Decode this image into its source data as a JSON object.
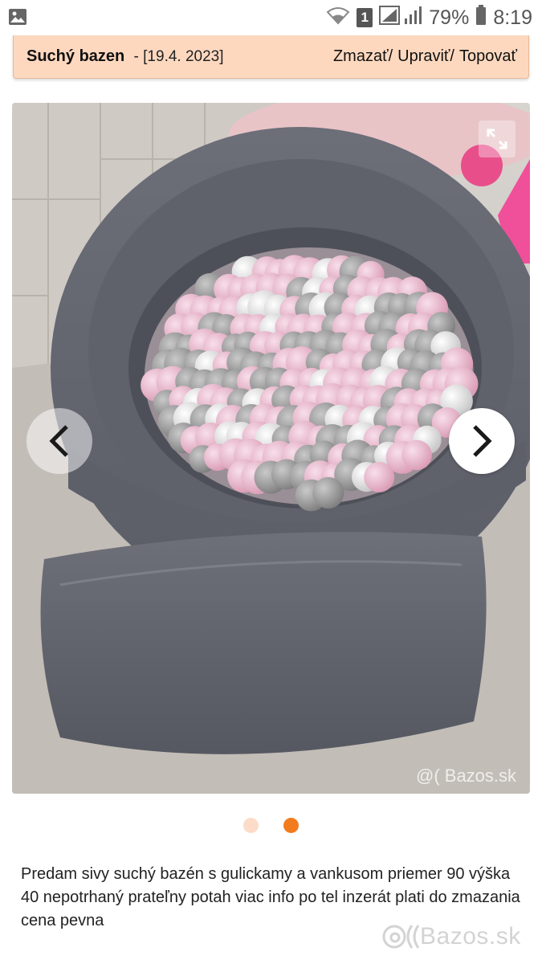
{
  "status_bar": {
    "sim_badge": "1",
    "battery": "79%",
    "time": "8:19",
    "icons": [
      "gallery-icon",
      "wifi-icon",
      "signal-icon",
      "battery-icon"
    ]
  },
  "ad": {
    "title": "Suchý bazen",
    "date": " - [19.4. 2023]",
    "actions": {
      "delete": "Zmazať/",
      "edit": "Upraviť/",
      "top": "Topovať"
    }
  },
  "gallery": {
    "watermark": "@( Bazos.sk",
    "expand_icon": "expand-icon",
    "prev_icon": "chevron-left-icon",
    "next_icon": "chevron-right-icon",
    "dot_colors": {
      "inactive": "#fcdcc8",
      "active": "#f27b1d"
    }
  },
  "description": "Predam sivy suchý bazén s gulickamy a vankusom priemer 90 výška 40 nepotrhaný prateľny potah viac info po tel inzerát plati do zmazania cena pevna",
  "footer": {
    "logo_text": "Bazos.sk"
  },
  "colors": {
    "header_bg": "#fdd8bf",
    "accent": "#f27b1d"
  }
}
